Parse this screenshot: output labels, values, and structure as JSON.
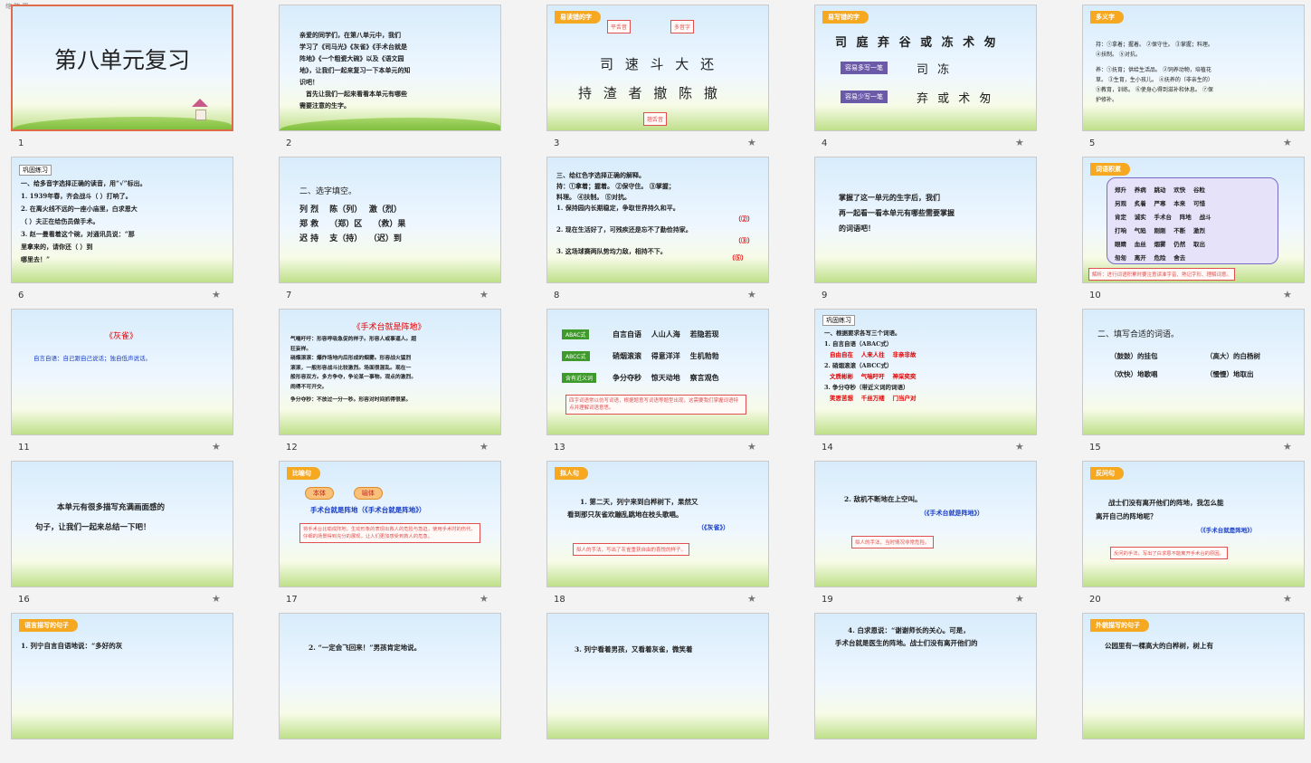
{
  "topbar": "缩 略 图",
  "slides": [
    {
      "num": "1",
      "title": "第八单元复习"
    },
    {
      "num": "2",
      "lines": [
        "亲爱的同学们，在第八单元中，我们",
        "学习了《司马光》《灰雀》《手术台就是",
        "阵地》《一个粗瓷大碗》以及《语文园",
        "地》，让我们一起来复习一下本单元的知",
        "识吧！",
        "　首先让我们一起来看看本单元有哪些",
        "需要注意的生字。"
      ]
    },
    {
      "num": "3",
      "tag": "易读错的字",
      "label1": "平舌音",
      "label2": "多音字",
      "label3": "翘舌音",
      "row1": "司 速 斗 大 还",
      "row2": "持 渣 者 撤 陈 撤"
    },
    {
      "num": "4",
      "tag": "易写错的字",
      "row": "司 庭 弃 谷 或 冻 术 匆",
      "btn1": "容易多写一笔",
      "w1": "司 冻",
      "btn2": "容易少写一笔",
      "w2": "弃 或 术 匆"
    },
    {
      "num": "5",
      "tag": "多义字",
      "l1": "持：①拿着；握着。 ②保守住。 ③掌握；料理。",
      "l1b": "④扶制。 ⑤对抗。",
      "l2": "养：①抚育；供给生活品。 ②饲养动物，培植花",
      "l2b": "草。 ③生育，生小孩儿。 ④抚养的（非亲生的）",
      "l2c": "⑤教育，训练。 ⑥使身心得到滋补和休息。 ⑦保",
      "l2d": "护修补。"
    },
    {
      "num": "6",
      "head": "巩固练习",
      "l1": "一、给多音字选择正确的读音，用“√”标出。",
      "l2": "1. 1939年春，齐会战斗（ ）打响了。",
      "l3": "2. 在离火线不远的一座小庙里，白求恩大",
      "l4": "（ ）夫正在给伤员做手术。",
      "l5": "3. 赵一曼看着这个碗，对通讯员说：“那",
      "l6": "里拿来的，请你还（ ）到",
      "l7": "哪里去！”"
    },
    {
      "num": "7",
      "l1": "二、选字填空。",
      "r1": "列 烈　 陈（列）　 激（烈）",
      "r2": "郑 救　 （郑）区　 （救）果",
      "r3": "迟 持　 支（持）　 （迟）到"
    },
    {
      "num": "8",
      "l1": "三、给红色字选择正确的解释。",
      "l2": "持：①拿着；握着。 ②保守住。 ③掌握；",
      "l3": "料理。 ④扶制。 ⑤对抗。",
      "l4": "1. 保持园内长期稳定，争取世界持久和平。",
      "a1": "（②）",
      "l5": "2. 现在生活好了，可残疾还是忘不了勤俭持家。",
      "a2": "（③）",
      "l6": "3. 这场球赛两队势均力敌，相持不下。",
      "a3": "（⑤）"
    },
    {
      "num": "9",
      "l1": "掌握了这一单元的生字后，我们",
      "l2": "再一起看一看本单元有哪些需要掌握",
      "l3": "的词语吧！"
    },
    {
      "num": "10",
      "tag": "词语积累",
      "rows": [
        "郑升　 养病　 跳动　 欢快　 谷粒",
        "另观　 炙着　 严寒　 本来　 可惜",
        "肯定　 诚实　 手术台　 阵地　 战斗",
        "打响　 气陷　 刚刚　 不断　 激烈",
        "眼睛　 血丝　 烟雾　 仍然　 取出",
        "匆匆　 离开　 危险　 舍去"
      ],
      "note": "解析：进行词语积累时要注意读准字音、熟记字形、理解词意。"
    },
    {
      "num": "11",
      "title": "《灰雀》",
      "body": "自言自语：自己跟自己说话；独自低声说话。"
    },
    {
      "num": "12",
      "title": "《手术台就是阵地》",
      "t1": "气喘吁吁：形容呼吸急促的样子。形容人或事逼人。超",
      "t1b": "狂妄样。",
      "t2": "硝烟滚滚：爆炸场地内后形成的烟雾。形容战火猛烈",
      "t2b": "滚滚，一般形容战斗比较激烈。场面很混乱。现在一",
      "t2c": "般形容双方。多方争夺，争论某一事物。观点的激烈。",
      "t2d": "闹得不可开交。",
      "t3": "争分夺秒：不放过一分一秒。形容对时间抓得很紧。"
    },
    {
      "num": "13",
      "b1": "ABAC式",
      "w1": "自言自语　 人山人海　 若隐若现",
      "b2": "ABCC式",
      "w2": "硝烟滚滚　 得意洋洋　 生机勃勃",
      "b3": "含有近义词",
      "w3": "争分夺秒　 惊天动地　 察言观色",
      "note": "四字词语常以仿写词语，根据题意写词语等题型出现，这需要我们掌握词语特点并理解词语意思。"
    },
    {
      "num": "14",
      "head": "巩固练习",
      "l1": "一、根据要求各写三个词语。",
      "s1": "1. 自言自语（ABAC式）",
      "a1": "自由自在　 人来人往　 非亲非故",
      "s2": "2. 硝烟滚滚（ABCC式）",
      "a2": "文质彬彬　 气喘吁吁　 神采奕奕",
      "s3": "3. 争分夺秒（带近义词的词语）",
      "a3": "笑思苦想　 千丝万缕　 门当户对"
    },
    {
      "num": "15",
      "l1": "二、填写合适的词语。",
      "a": "（鼓鼓）的挂包",
      "b": "（高大）的白杨树",
      "c": "（欢快）地歌唱",
      "d": "（慢慢）地取出"
    },
    {
      "num": "16",
      "l1": "本单元有很多描写充满画面感的",
      "l2": "句子，让我们一起来总结一下吧！"
    },
    {
      "num": "17",
      "tag": "比喻句",
      "p1": "本体",
      "p2": "喻体",
      "title": "手术台就是阵地（《手术台就是阵地》）",
      "note": "将手术台比喻成阵地，生动形象的表现出救人的危险与急迫，使用手术时的伤代、仔细的场景得到充分的展现，让人们更加感受到救人的危急。"
    },
    {
      "num": "18",
      "tag": "拟人句",
      "l1": "1. 第二天，列宁来到白桦树下，果然又",
      "l2": "看到那只灰雀欢蹦乱跳地在枝头歌唱。",
      "src": "（《灰雀》）",
      "note": "拟人的手法，写出了灰雀重获自由的喜悦的样子。"
    },
    {
      "num": "19",
      "l1": "2. 敌机不断地在上空叫。",
      "src": "（《手术台就是阵地》）",
      "note": "拟人的手法，当时情况非常危险。"
    },
    {
      "num": "20",
      "tag": "反问句",
      "l1": "战士们没有离开他们的阵地，我怎么能",
      "l2": "离开自己的阵地呢？",
      "src": "（《手术台就是阵地》）",
      "note": "反问的手法，写出了白求恩不能离开手术台的原因。"
    },
    {
      "num": "21",
      "tag": "语言描写的句子",
      "l1": "1. 列宁自言自语地说：“多好的灰"
    },
    {
      "num": "22",
      "l1": "2. “一定会飞回来！”男孩肯定地说。"
    },
    {
      "num": "23",
      "l1": "3. 列宁看着男孩，又看着灰雀，微笑着"
    },
    {
      "num": "24",
      "l1": "4. 白求恩说：“谢谢师长的关心。可是，",
      "l2": "手术台就是医生的阵地。战士们没有离开他们的"
    },
    {
      "num": "25",
      "tag": "外貌描写的句子",
      "l1": "公园里有一棵高大的白桦树，树上有"
    }
  ]
}
